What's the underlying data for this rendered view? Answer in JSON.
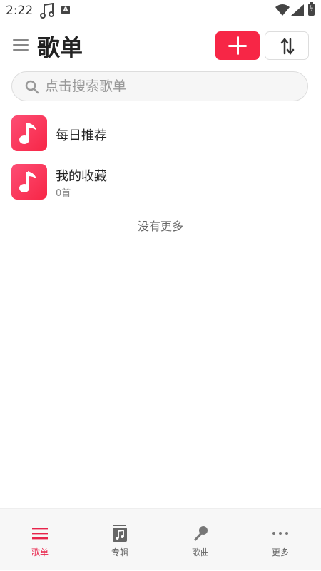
{
  "status_bar": {
    "time": "2:22",
    "a_badge": "A",
    "battery_glyph": "ϟ"
  },
  "header": {
    "title": "歌单",
    "menu_icon": "hamburger-icon",
    "add_icon": "plus-icon",
    "sort_icon": "sort-arrows-icon",
    "accent_color": "#f72646"
  },
  "search": {
    "placeholder": "点击搜索歌单",
    "value": ""
  },
  "playlists": [
    {
      "name": "每日推荐",
      "count": ""
    },
    {
      "name": "我的收藏",
      "count": "0首"
    }
  ],
  "list_end_text": "没有更多",
  "bottom_nav": [
    {
      "label": "歌单",
      "icon": "list-icon",
      "active": true
    },
    {
      "label": "专辑",
      "icon": "album-icon",
      "active": false
    },
    {
      "label": "歌曲",
      "icon": "microphone-icon",
      "active": false
    },
    {
      "label": "更多",
      "icon": "more-dots-icon",
      "active": false
    }
  ]
}
